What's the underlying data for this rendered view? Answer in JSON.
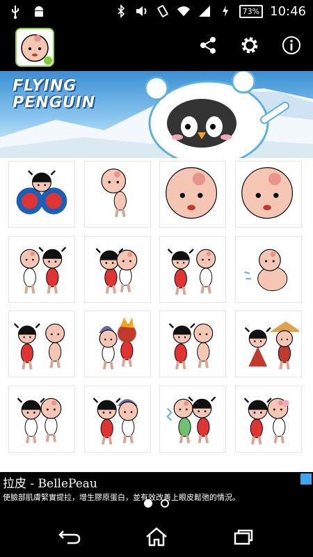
{
  "status_bar": {
    "battery_percent": "73%",
    "time": "10:46",
    "icons": [
      "usb-icon",
      "android-icon",
      "bluetooth-icon",
      "volume-icon",
      "rotation-icon",
      "wifi-icon",
      "signal-icon",
      "charging-icon"
    ]
  },
  "app_bar": {
    "icon": "app-icon-baby-face",
    "actions": [
      "share-icon",
      "settings-icon",
      "info-icon"
    ]
  },
  "banner": {
    "title_line1": "FLYING",
    "title_line2": "PENGUIN"
  },
  "sticker_grid": {
    "columns": 4,
    "rows": 4,
    "stickers": [
      "sticker-girl-with-cymbals",
      "sticker-baby-running",
      "sticker-baby-face-blush",
      "sticker-baby-face-worried",
      "sticker-baby-and-girl-standing",
      "sticker-girl-and-baby-hug",
      "sticker-girl-and-baby-turned",
      "sticker-baby-sitting-sad",
      "sticker-girl-and-baby-standing",
      "sticker-baby-angry-fire",
      "sticker-girl-and-baby-back",
      "sticker-girl-with-hat",
      "sticker-girl-and-baby-together",
      "sticker-girl-and-baby-with-beanie",
      "sticker-girl-and-baby-shocked",
      "sticker-girl-kissing-baby"
    ]
  },
  "ad": {
    "title": "拉皮 - BellePeau",
    "body": "使臉部肌膚緊實提拉，增生膠原蛋白，並有效改善上眼皮鬆弛的情況。",
    "page_indicator": {
      "pages": 2,
      "current": 1
    }
  },
  "nav_bar": {
    "buttons": [
      "back-icon",
      "home-icon",
      "recents-icon"
    ]
  }
}
